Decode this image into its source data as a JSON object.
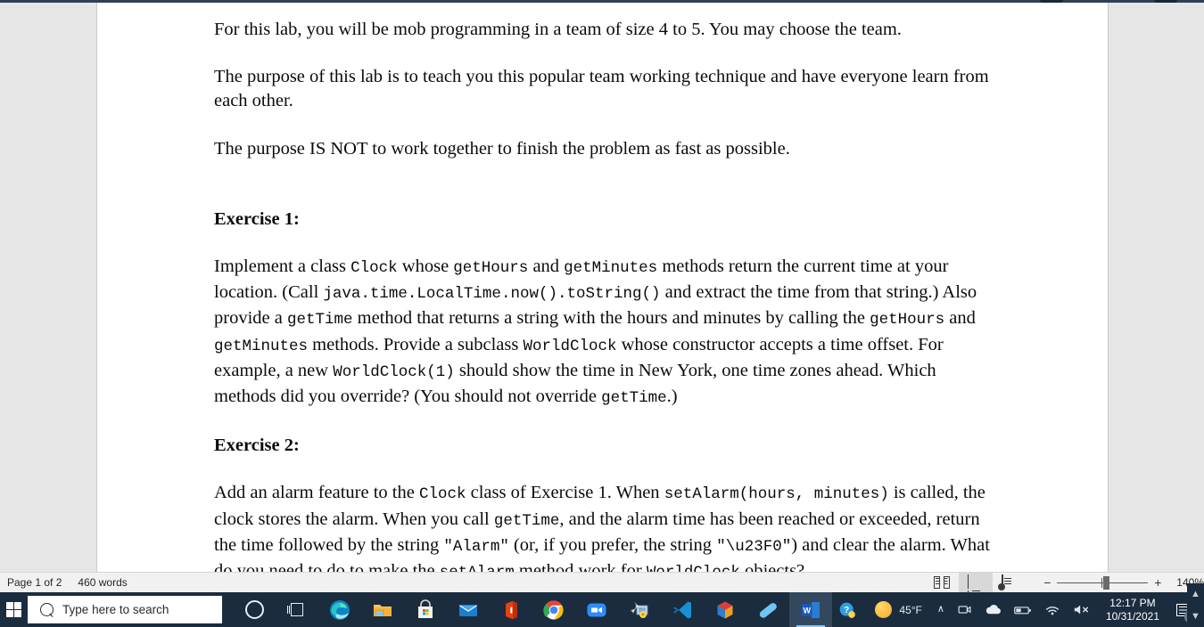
{
  "document": {
    "paragraphs": [
      {
        "type": "para",
        "runs": [
          {
            "t": "For this lab, you will be mob programming in a team of size 4 to 5. You may choose the team.",
            "m": false
          }
        ]
      },
      {
        "type": "para",
        "runs": [
          {
            "t": "The purpose of this lab is to teach you this popular team working technique and have everyone learn from each other.",
            "m": false
          }
        ]
      },
      {
        "type": "para",
        "runs": [
          {
            "t": "The purpose IS NOT to work together to finish the problem as fast as possible.",
            "m": false
          }
        ]
      }
    ],
    "exercise1": {
      "heading": "Exercise 1:",
      "runs": [
        {
          "t": "Implement a class ",
          "m": false
        },
        {
          "t": "Clock",
          "m": true
        },
        {
          "t": " whose ",
          "m": false
        },
        {
          "t": "getHours",
          "m": true
        },
        {
          "t": " and ",
          "m": false
        },
        {
          "t": "getMinutes",
          "m": true
        },
        {
          "t": " methods return the current time at your location. (Call ",
          "m": false
        },
        {
          "t": "java.time.LocalTime.now().toString()",
          "m": true
        },
        {
          "t": " and extract the time from that string.) Also provide a ",
          "m": false
        },
        {
          "t": "getTime",
          "m": true
        },
        {
          "t": " method that returns a string with the hours and minutes by calling the ",
          "m": false
        },
        {
          "t": "getHours",
          "m": true
        },
        {
          "t": " and ",
          "m": false
        },
        {
          "t": "getMinutes",
          "m": true
        },
        {
          "t": " methods. Provide a subclass ",
          "m": false
        },
        {
          "t": "WorldClock",
          "m": true
        },
        {
          "t": " whose constructor accepts a time offset. For example, a new ",
          "m": false
        },
        {
          "t": "WorldClock(1)",
          "m": true
        },
        {
          "t": " should show the time in New York, one time zones ahead. Which methods did you override? (You should not override ",
          "m": false
        },
        {
          "t": "getTime",
          "m": true
        },
        {
          "t": ".)",
          "m": false
        }
      ]
    },
    "exercise2": {
      "heading": "Exercise 2:",
      "runs": [
        {
          "t": "Add an alarm feature to the ",
          "m": false
        },
        {
          "t": "Clock",
          "m": true
        },
        {
          "t": " class of Exercise 1. When ",
          "m": false
        },
        {
          "t": "setAlarm(hours, minutes)",
          "m": true
        },
        {
          "t": " is called, the clock stores the alarm. When you call ",
          "m": false
        },
        {
          "t": "getTime",
          "m": true
        },
        {
          "t": ", and the alarm time has been reached or exceeded, return the time followed by the string ",
          "m": false
        },
        {
          "t": "\"Alarm\"",
          "m": true
        },
        {
          "t": " (or, if you prefer, the string ",
          "m": false
        },
        {
          "t": "\"\\u23F0\"",
          "m": true
        },
        {
          "t": ") and clear the alarm. What do you need to do to make the ",
          "m": false
        },
        {
          "t": "setAlarm",
          "m": true
        },
        {
          "t": " method work for ",
          "m": false
        },
        {
          "t": "WorldClock",
          "m": true
        },
        {
          "t": " objects?",
          "m": false
        }
      ]
    }
  },
  "status_bar": {
    "page_indicator": "Page 1 of 2",
    "word_count": "460 words",
    "views": [
      {
        "name": "read-mode",
        "label": "Read Mode",
        "active": false
      },
      {
        "name": "print-layout",
        "label": "Print Layout",
        "active": true
      },
      {
        "name": "web-layout",
        "label": "Web Layout",
        "active": false
      }
    ],
    "zoom": {
      "minus": "−",
      "plus": "+",
      "value": "140%"
    }
  },
  "taskbar": {
    "start_label": "Start",
    "search_placeholder": "Type here to search",
    "apps": [
      {
        "name": "cortana",
        "label": "Cortana"
      },
      {
        "name": "task-view",
        "label": "Task View"
      },
      {
        "name": "microsoft-edge",
        "label": "Microsoft Edge"
      },
      {
        "name": "file-explorer",
        "label": "File Explorer"
      },
      {
        "name": "microsoft-store",
        "label": "Microsoft Store"
      },
      {
        "name": "mail",
        "label": "Mail"
      },
      {
        "name": "office",
        "label": "Office"
      },
      {
        "name": "google-chrome",
        "label": "Google Chrome"
      },
      {
        "name": "zoom",
        "label": "Zoom"
      },
      {
        "name": "app-launcher",
        "label": "Launcher"
      },
      {
        "name": "visual-studio-code",
        "label": "Visual Studio Code"
      },
      {
        "name": "package-3d",
        "label": "3D Viewer"
      },
      {
        "name": "blue-capsule-app",
        "label": "App"
      },
      {
        "name": "microsoft-word",
        "label": "Word",
        "active": true
      }
    ],
    "tray": {
      "help_label": "Help",
      "weather_temp": "45°F",
      "show_hidden": "∧",
      "time": "12:17 PM",
      "date": "10/31/2021",
      "notification_count": "1"
    }
  },
  "colors": {
    "ribbon": "#2b4256",
    "taskbar": "#1b2c3e",
    "page": "#ffffff",
    "workspace": "#e6e6e6",
    "statusbar": "#f1f1f1",
    "word_accent": "#2b579a",
    "active_underline": "#7fc7f5"
  }
}
